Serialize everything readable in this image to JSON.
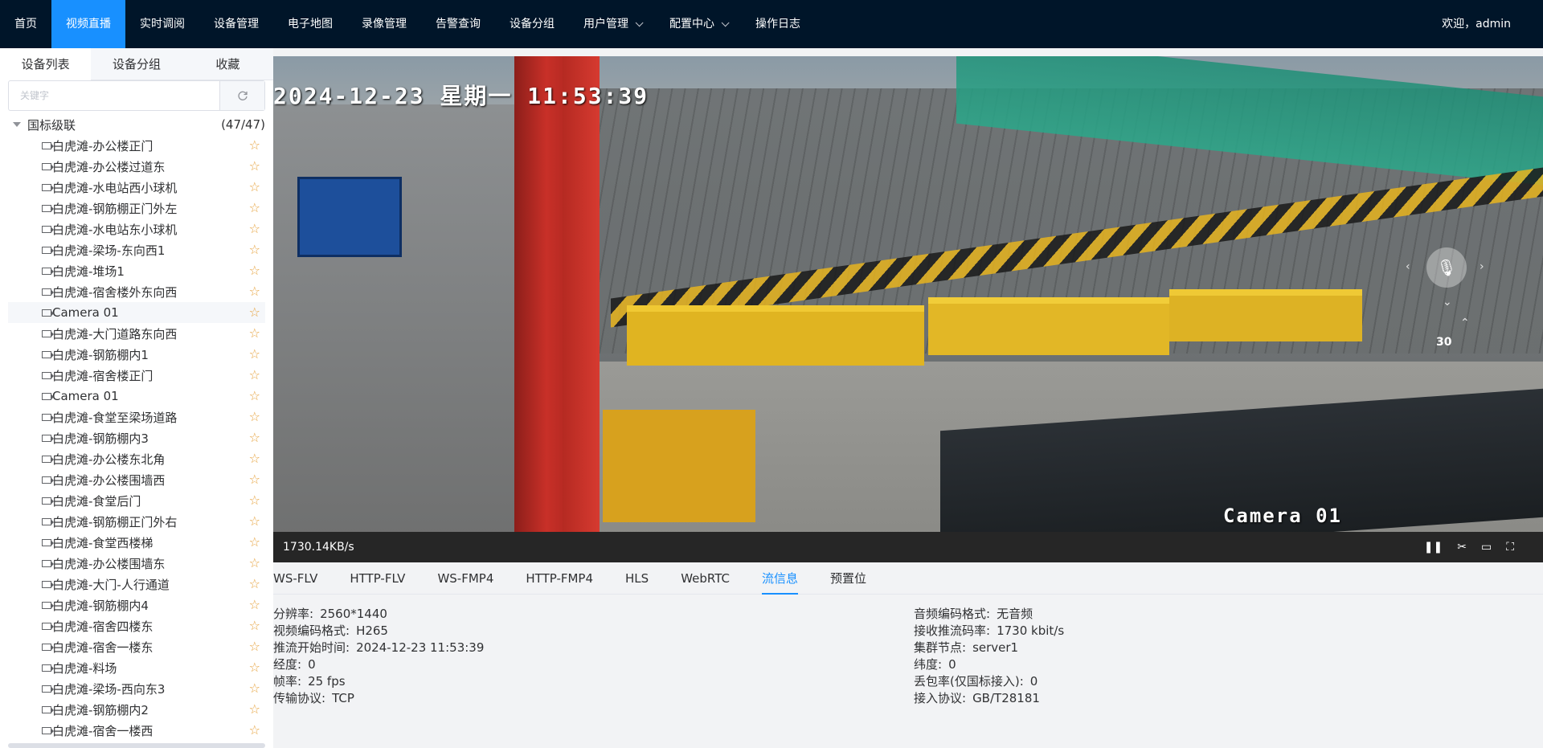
{
  "nav": {
    "items": [
      {
        "label": "首页"
      },
      {
        "label": "视频直播"
      },
      {
        "label": "实时调阅"
      },
      {
        "label": "设备管理"
      },
      {
        "label": "电子地图"
      },
      {
        "label": "录像管理"
      },
      {
        "label": "告警查询"
      },
      {
        "label": "设备分组"
      },
      {
        "label": "用户管理"
      },
      {
        "label": "配置中心"
      },
      {
        "label": "操作日志"
      }
    ],
    "active": "视频直播",
    "welcome": "欢迎，admin"
  },
  "sidebar": {
    "tabs": [
      "设备列表",
      "设备分组",
      "收藏"
    ],
    "active_tab": "设备列表",
    "search_placeholder": "关键字",
    "root": {
      "label": "国标级联",
      "count": "(47/47)"
    },
    "devices": [
      "白虎滩-办公楼正门",
      "白虎滩-办公楼过道东",
      "白虎滩-水电站西小球机",
      "白虎滩-钢筋棚正门外左",
      "白虎滩-水电站东小球机",
      "白虎滩-梁场-东向西1",
      "白虎滩-堆场1",
      "白虎滩-宿舍楼外东向西",
      "Camera 01",
      "白虎滩-大门道路东向西",
      "白虎滩-钢筋棚内1",
      "白虎滩-宿舍楼正门",
      "Camera 01",
      "白虎滩-食堂至梁场道路",
      "白虎滩-钢筋棚内3",
      "白虎滩-办公楼东北角",
      "白虎滩-办公楼围墙西",
      "白虎滩-食堂后门",
      "白虎滩-钢筋棚正门外右",
      "白虎滩-食堂西楼梯",
      "白虎滩-办公楼围墙东",
      "白虎滩-大门-人行通道",
      "白虎滩-钢筋棚内4",
      "白虎滩-宿舍四楼东",
      "白虎滩-宿舍一楼东",
      "白虎滩-料场",
      "白虎滩-梁场-西向东3",
      "白虎滩-钢筋棚内2",
      "白虎滩-宿舍一楼西"
    ]
  },
  "video": {
    "osd_time": "2024-12-23 星期一 11:53:39",
    "osd_camera": "Camera 01",
    "zoom": "30",
    "bitrate": "1730.14KB/s"
  },
  "stream_tabs": [
    "WS-FLV",
    "HTTP-FLV",
    "WS-FMP4",
    "HTTP-FMP4",
    "HLS",
    "WebRTC",
    "流信息",
    "预置位"
  ],
  "active_stream_tab": "流信息",
  "stream_info": {
    "left": [
      {
        "label": "分辨率:",
        "value": "2560*1440"
      },
      {
        "label": "视频编码格式:",
        "value": "H265"
      },
      {
        "label": "推流开始时间:",
        "value": "2024-12-23 11:53:39"
      },
      {
        "label": "经度:",
        "value": "0"
      },
      {
        "label": "帧率:",
        "value": "25 fps"
      },
      {
        "label": "传输协议:",
        "value": "TCP"
      }
    ],
    "right": [
      {
        "label": "音频编码格式:",
        "value": "无音频"
      },
      {
        "label": "接收推流码率:",
        "value": "1730 kbit/s"
      },
      {
        "label": "集群节点:",
        "value": "server1"
      },
      {
        "label": "纬度:",
        "value": "0"
      },
      {
        "label": "丢包率(仅国标接入):",
        "value": "0"
      },
      {
        "label": "接入协议:",
        "value": "GB/T28181"
      }
    ]
  }
}
